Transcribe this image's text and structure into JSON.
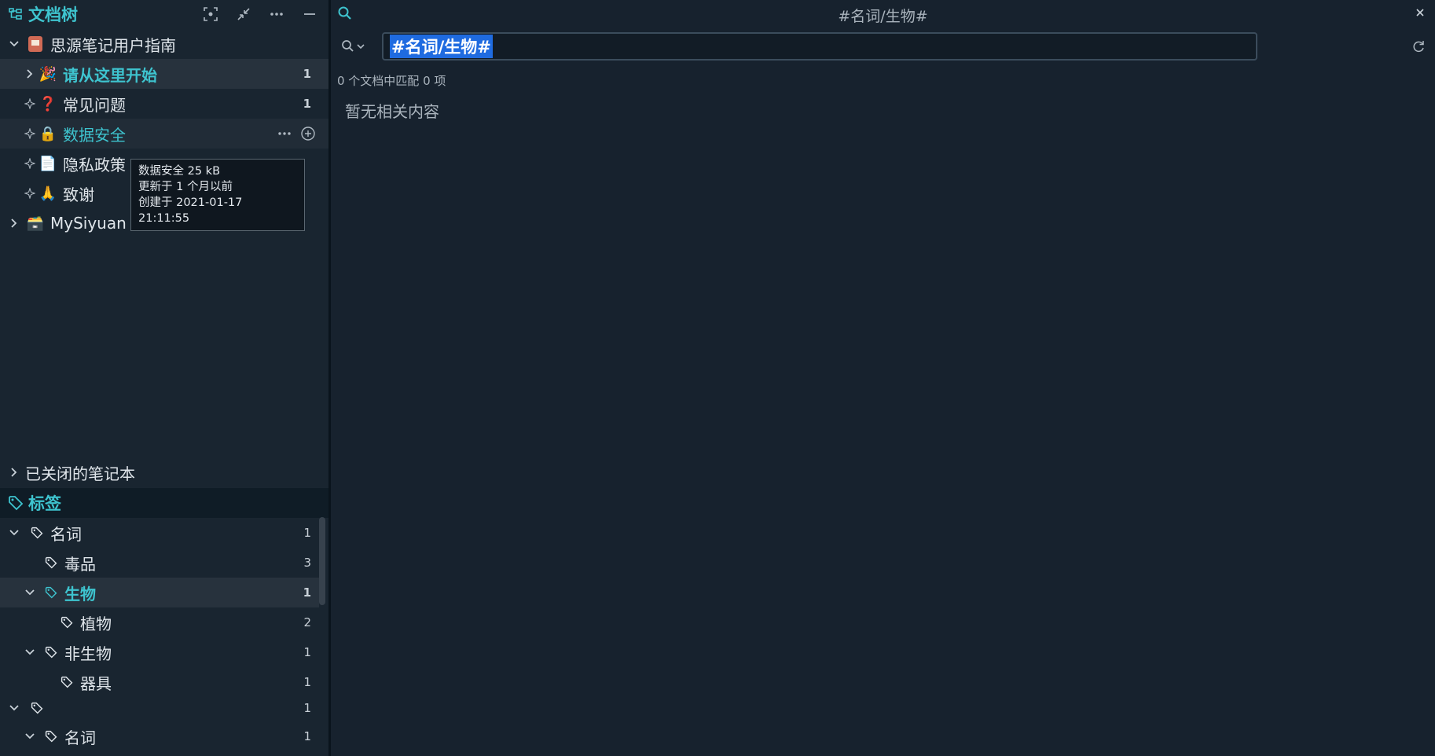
{
  "doc_tree": {
    "title": "文档树",
    "notebooks": [
      {
        "label": "思源笔记用户指南",
        "emoji": "📔"
      },
      {
        "label": "MySiyuan",
        "emoji": "🗃️"
      }
    ],
    "docs": [
      {
        "label": "请从这里开始",
        "emoji": "🎉",
        "count": "1"
      },
      {
        "label": "常见问题",
        "emoji": "❓",
        "count": "1"
      },
      {
        "label": "数据安全",
        "emoji": "🔒"
      },
      {
        "label": "隐私政策",
        "emoji": "📄"
      },
      {
        "label": "致谢",
        "emoji": "🙏"
      }
    ],
    "closed_notebooks": "已关闭的笔记本",
    "tooltip": {
      "line1": "数据安全 25 kB",
      "line2": "更新于 1 个月以前",
      "line3": "创建于 2021-01-17 21:11:55"
    }
  },
  "tags": {
    "title": "标签",
    "items": [
      {
        "label": "名词",
        "count": "1"
      },
      {
        "label": "毒品",
        "count": "3"
      },
      {
        "label": "生物",
        "count": "1"
      },
      {
        "label": "植物",
        "count": "2"
      },
      {
        "label": "非生物",
        "count": "1"
      },
      {
        "label": "器具",
        "count": "1"
      },
      {
        "label": "",
        "count": "1"
      },
      {
        "label": "名词",
        "count": "1"
      }
    ]
  },
  "search": {
    "title": "#名词/生物#",
    "query": "#名词/生物#",
    "result_info": "0 个文档中匹配 0 项",
    "empty_message": "暂无相关内容"
  },
  "colors": {
    "accent": "#3ec4cf",
    "selection": "#1f6be0",
    "panel_bg": "#192530",
    "main_bg": "#17222e"
  }
}
